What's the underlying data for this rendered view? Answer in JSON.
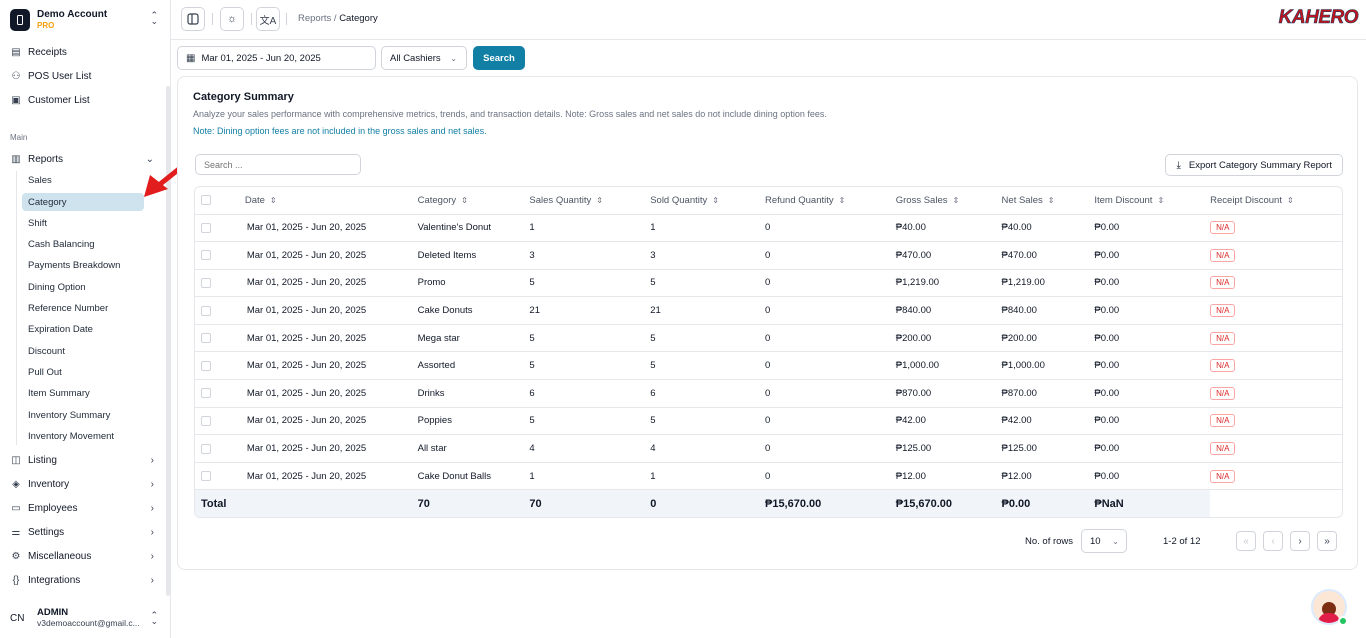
{
  "account": {
    "name": "Demo Account",
    "plan": "PRO"
  },
  "sidebar": {
    "top_items": [
      {
        "label": "Receipts"
      },
      {
        "label": "POS User List"
      },
      {
        "label": "Customer List"
      }
    ],
    "section_label": "Main",
    "reports_label": "Reports",
    "report_sub_items": [
      "Sales",
      "Category",
      "Shift",
      "Cash Balancing",
      "Payments Breakdown",
      "Dining Option",
      "Reference Number",
      "Expiration Date",
      "Discount",
      "Pull Out",
      "Item Summary",
      "Inventory Summary",
      "Inventory Movement"
    ],
    "active_sub_item": "Category",
    "bottom_items": [
      {
        "label": "Listing"
      },
      {
        "label": "Inventory"
      },
      {
        "label": "Employees"
      },
      {
        "label": "Settings"
      },
      {
        "label": "Miscellaneous"
      },
      {
        "label": "Integrations"
      }
    ]
  },
  "user": {
    "initials": "CN",
    "name": "ADMIN",
    "email": "v3demoaccount@gmail.c..."
  },
  "breadcrumb": {
    "parent": "Reports",
    "separator": "/",
    "current": "Category"
  },
  "brand": "KAHERO",
  "filters": {
    "date_range": "Mar 01, 2025 - Jun 20, 2025",
    "cashier": "All Cashiers",
    "search_label": "Search"
  },
  "card": {
    "title": "Category Summary",
    "description": "Analyze your sales performance with comprehensive metrics, trends, and transaction details. Note: Gross sales and net sales do not include dining option fees.",
    "note": "Note: Dining option fees are not included in the gross sales and net sales.",
    "search_placeholder": "Search ...",
    "export_label": "Export Category Summary Report"
  },
  "table": {
    "columns": [
      "Date",
      "Category",
      "Sales Quantity",
      "Sold Quantity",
      "Refund Quantity",
      "Gross Sales",
      "Net Sales",
      "Item Discount",
      "Receipt Discount"
    ],
    "rows": [
      [
        "Mar 01, 2025 - Jun 20, 2025",
        "Valentine's Donut",
        "1",
        "1",
        "0",
        "₱40.00",
        "₱40.00",
        "₱0.00",
        "N/A"
      ],
      [
        "Mar 01, 2025 - Jun 20, 2025",
        "Deleted Items",
        "3",
        "3",
        "0",
        "₱470.00",
        "₱470.00",
        "₱0.00",
        "N/A"
      ],
      [
        "Mar 01, 2025 - Jun 20, 2025",
        "Promo",
        "5",
        "5",
        "0",
        "₱1,219.00",
        "₱1,219.00",
        "₱0.00",
        "N/A"
      ],
      [
        "Mar 01, 2025 - Jun 20, 2025",
        "Cake Donuts",
        "21",
        "21",
        "0",
        "₱840.00",
        "₱840.00",
        "₱0.00",
        "N/A"
      ],
      [
        "Mar 01, 2025 - Jun 20, 2025",
        "Mega star",
        "5",
        "5",
        "0",
        "₱200.00",
        "₱200.00",
        "₱0.00",
        "N/A"
      ],
      [
        "Mar 01, 2025 - Jun 20, 2025",
        "Assorted",
        "5",
        "5",
        "0",
        "₱1,000.00",
        "₱1,000.00",
        "₱0.00",
        "N/A"
      ],
      [
        "Mar 01, 2025 - Jun 20, 2025",
        "Drinks",
        "6",
        "6",
        "0",
        "₱870.00",
        "₱870.00",
        "₱0.00",
        "N/A"
      ],
      [
        "Mar 01, 2025 - Jun 20, 2025",
        "Poppies",
        "5",
        "5",
        "0",
        "₱42.00",
        "₱42.00",
        "₱0.00",
        "N/A"
      ],
      [
        "Mar 01, 2025 - Jun 20, 2025",
        "All star",
        "4",
        "4",
        "0",
        "₱125.00",
        "₱125.00",
        "₱0.00",
        "N/A"
      ],
      [
        "Mar 01, 2025 - Jun 20, 2025",
        "Cake Donut Balls",
        "1",
        "1",
        "0",
        "₱12.00",
        "₱12.00",
        "₱0.00",
        "N/A"
      ]
    ],
    "total": {
      "label": "Total",
      "sales_quantity": "70",
      "sold_quantity": "70",
      "refund_quantity": "0",
      "gross_sales": "₱15,670.00",
      "net_sales": "₱15,670.00",
      "item_discount": "₱0.00",
      "receipt_discount": "₱NaN"
    }
  },
  "pagination": {
    "rows_label": "No. of rows",
    "rows_value": "10",
    "page_info": "1-2 of 12"
  },
  "colors": {
    "primary": "#127fa4",
    "active_bg": "#cfe3ee",
    "arrow": "#e11d1d",
    "badge": "#dc2626"
  },
  "icons": {
    "sidebar_toggle": "panel-left-icon",
    "theme": "sun-icon",
    "language": "translate-icon"
  }
}
